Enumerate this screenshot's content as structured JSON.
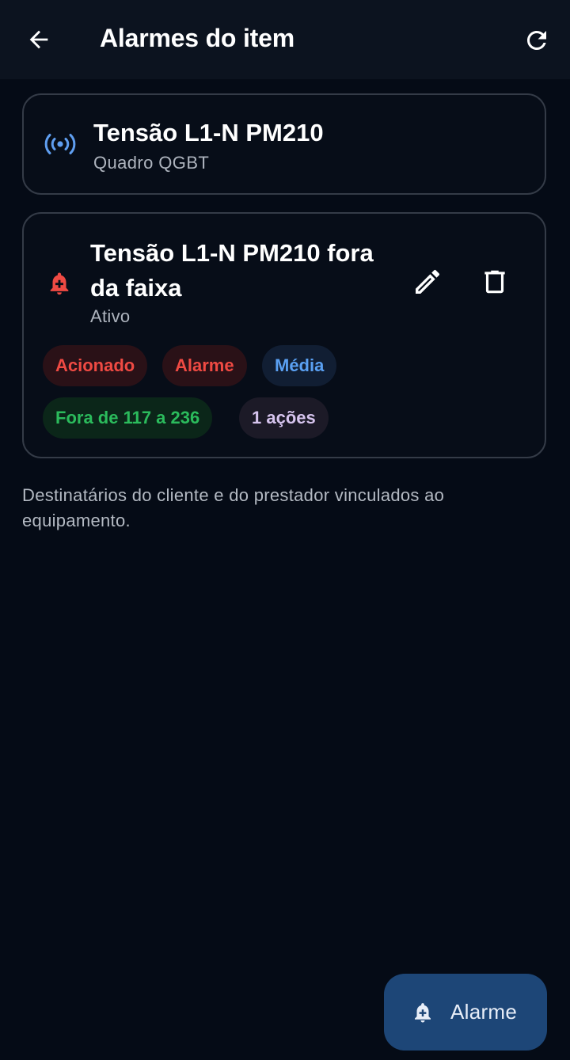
{
  "appbar": {
    "title": "Alarmes do item",
    "back_icon": "arrow-back-icon",
    "refresh_icon": "refresh-icon"
  },
  "item": {
    "name": "Tensão L1-N PM210",
    "location": "Quadro QGBT",
    "icon": "sensor-signal-icon"
  },
  "alarm": {
    "title": "Tensão L1-N PM210 fora da faixa",
    "status": "Ativo",
    "icon": "bell-plus-icon",
    "chips": [
      "Acionado",
      "Alarme",
      "Média",
      "Fora de 117 a 236",
      "1 ações"
    ]
  },
  "note": "Destinatários do cliente e do prestador vinculados ao equipamento.",
  "fab": {
    "label": "Alarme",
    "icon": "add-alarm-icon"
  },
  "colors": {
    "background": "#050b16",
    "appbar": "#0c131f",
    "danger": "#ef4a43",
    "info": "#5aa0f2",
    "success": "#2bbb5c",
    "fab": "#1d4677"
  }
}
